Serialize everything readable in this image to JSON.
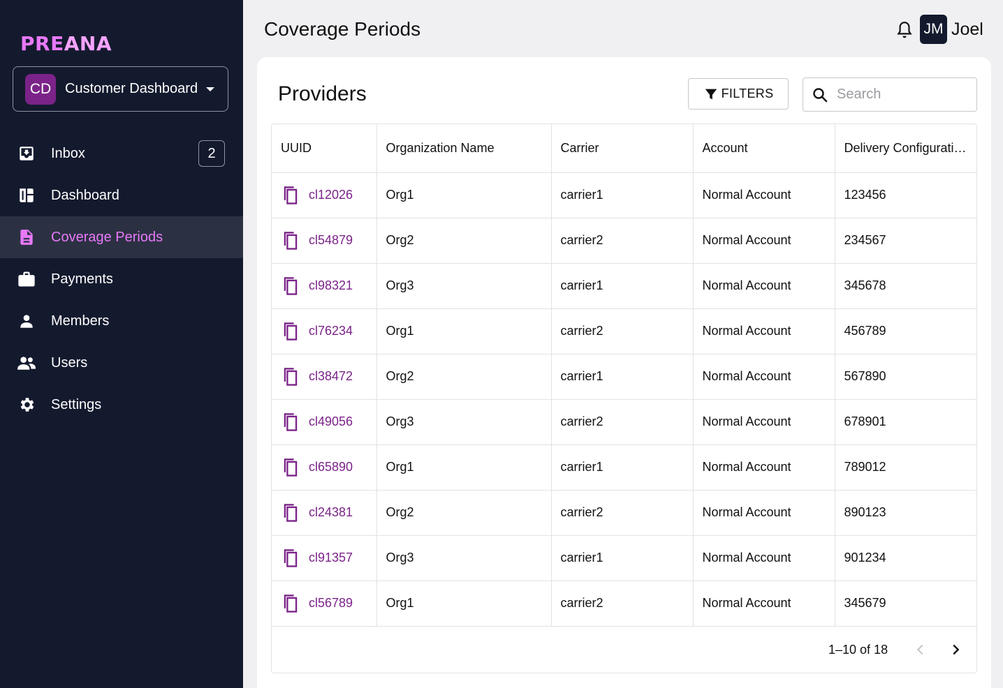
{
  "app": {
    "logo_a": "PRE",
    "logo_b": "ANA"
  },
  "org": {
    "initials": "CD",
    "name": "Customer Dashboard"
  },
  "colors": {
    "sidebar_bg": "#141a2e",
    "accent": "#e879f9",
    "link": "#7b2389"
  },
  "nav": [
    {
      "label": "Inbox",
      "icon": "inbox-icon",
      "badge": "2"
    },
    {
      "label": "Dashboard",
      "icon": "dashboard-icon"
    },
    {
      "label": "Coverage Periods",
      "icon": "document-icon",
      "active": true
    },
    {
      "label": "Payments",
      "icon": "briefcase-icon"
    },
    {
      "label": "Members",
      "icon": "person-icon"
    },
    {
      "label": "Users",
      "icon": "people-icon"
    },
    {
      "label": "Settings",
      "icon": "gear-icon"
    }
  ],
  "header": {
    "title": "Coverage Periods",
    "user_initials": "JM",
    "user_name": "Joel"
  },
  "card": {
    "title": "Providers",
    "filters_label": "FILTERS",
    "search_placeholder": "Search"
  },
  "table": {
    "columns": [
      "UUID",
      "Organization Name",
      "Carrier",
      "Account",
      "Delivery Configurati…"
    ],
    "rows": [
      [
        "cl12026",
        "Org1",
        "carrier1",
        "Normal Account",
        "123456"
      ],
      [
        "cl54879",
        "Org2",
        "carrier2",
        "Normal Account",
        "234567"
      ],
      [
        "cl98321",
        "Org3",
        "carrier1",
        "Normal Account",
        "345678"
      ],
      [
        "cl76234",
        "Org1",
        "carrier2",
        "Normal Account",
        "456789"
      ],
      [
        "cl38472",
        "Org2",
        "carrier1",
        "Normal Account",
        "567890"
      ],
      [
        "cl49056",
        "Org3",
        "carrier2",
        "Normal Account",
        "678901"
      ],
      [
        "cl65890",
        "Org1",
        "carrier1",
        "Normal Account",
        "789012"
      ],
      [
        "cl24381",
        "Org2",
        "carrier2",
        "Normal Account",
        "890123"
      ],
      [
        "cl91357",
        "Org3",
        "carrier1",
        "Normal Account",
        "901234"
      ],
      [
        "cl56789",
        "Org1",
        "carrier2",
        "Normal Account",
        "345679"
      ]
    ]
  },
  "pagination": {
    "text": "1–10 of 18"
  }
}
